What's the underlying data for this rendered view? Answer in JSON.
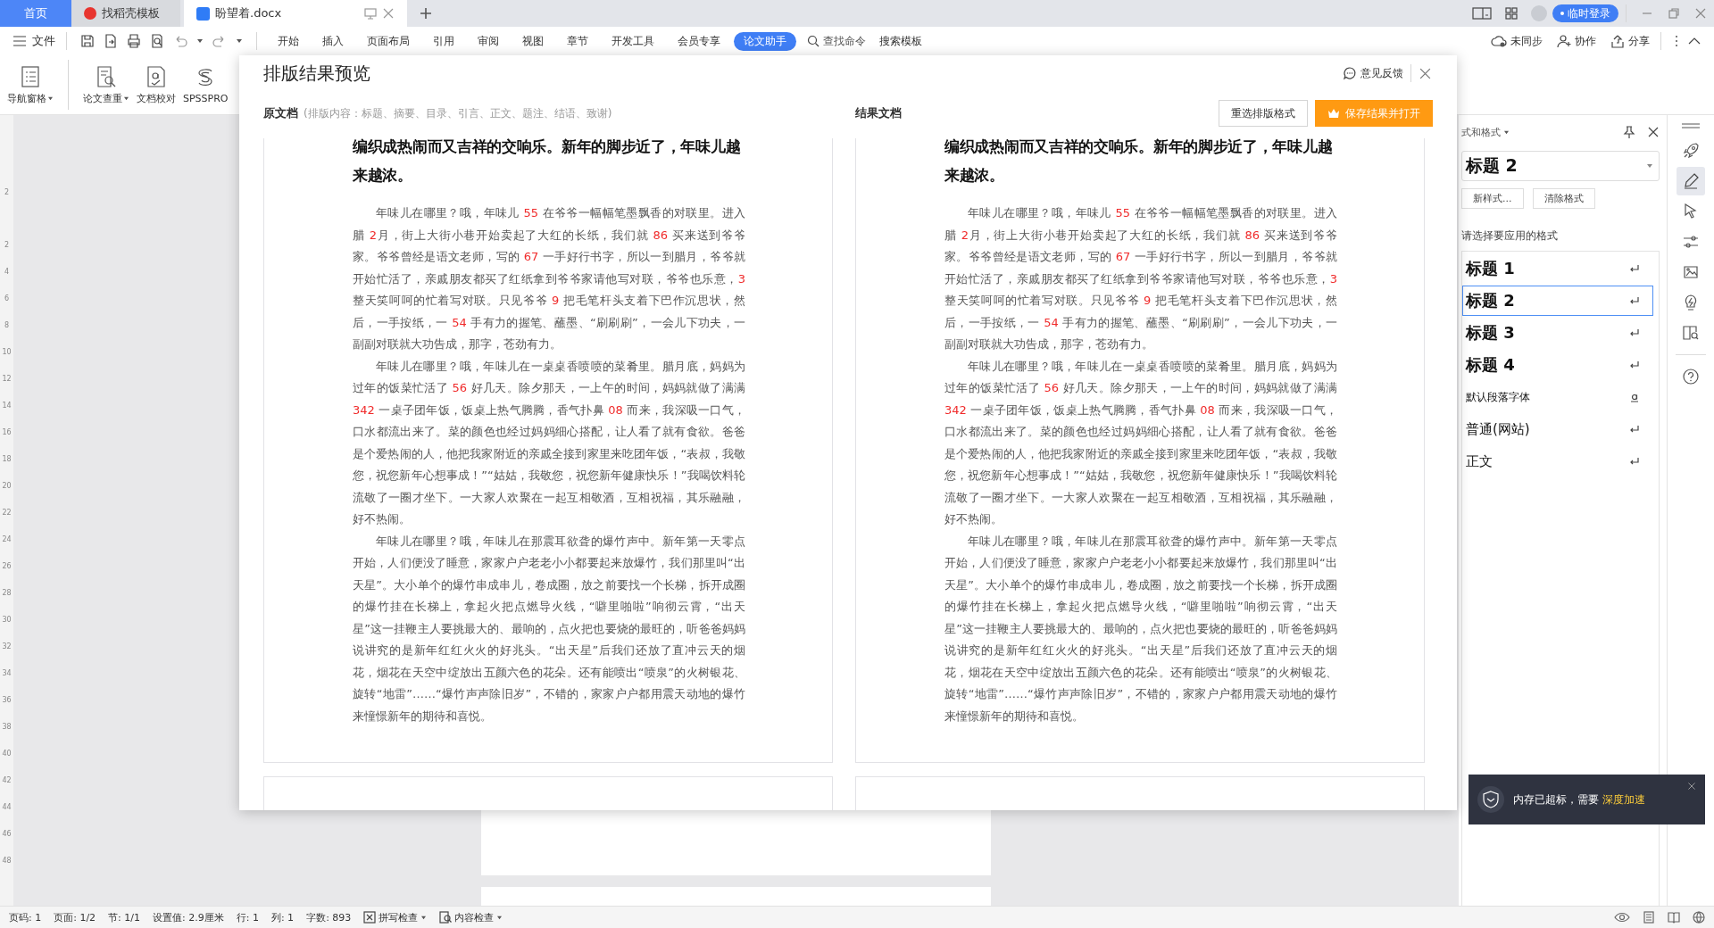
{
  "tab_bar": {
    "tabs": [
      {
        "label": "首页",
        "kind": "home",
        "selected": false
      },
      {
        "label": "找稻壳模板",
        "kind": "template",
        "selected": false
      },
      {
        "label": "盼望着.docx",
        "kind": "document",
        "selected": true
      }
    ],
    "login": "临时登录"
  },
  "toolbar": {
    "file_menu": "文件",
    "menu_tabs": [
      {
        "label": "开始",
        "selected": false
      },
      {
        "label": "插入",
        "selected": false
      },
      {
        "label": "页面布局",
        "selected": false
      },
      {
        "label": "引用",
        "selected": false
      },
      {
        "label": "审阅",
        "selected": false
      },
      {
        "label": "视图",
        "selected": false
      },
      {
        "label": "章节",
        "selected": false
      },
      {
        "label": "开发工具",
        "selected": false
      },
      {
        "label": "会员专享",
        "selected": false
      },
      {
        "label": "论文助手",
        "selected": true
      }
    ],
    "command_search": "查找命令",
    "template_search": "搜索模板",
    "actions": [
      {
        "label": "未同步",
        "kind": "sync"
      },
      {
        "label": "协作",
        "kind": "collab"
      },
      {
        "label": "分享",
        "kind": "share"
      }
    ]
  },
  "ribbon": {
    "items": [
      {
        "label": "导航窗格",
        "kind": "nav",
        "dropdown": true
      },
      {
        "label": "论文查重",
        "kind": "check",
        "dropdown": true
      },
      {
        "label": "文档校对",
        "kind": "proof",
        "dropdown": false
      },
      {
        "label": "SPSSPRO",
        "kind": "spss",
        "dropdown": false
      }
    ]
  },
  "ruler_marks": [
    "2",
    "2",
    "4",
    "6",
    "8",
    "10",
    "12",
    "14",
    "16",
    "18",
    "20",
    "22",
    "24",
    "26",
    "28",
    "30",
    "32",
    "34",
    "36",
    "38",
    "40",
    "42",
    "44",
    "46",
    "48"
  ],
  "dialog": {
    "title": "排版结果预览",
    "feedback": "意见反馈",
    "original_label": "原文档",
    "original_note": "(排版内容：标题、摘要、目录、引言、正文、题注、结语、致谢)",
    "result_label": "结果文档",
    "buttons": [
      {
        "label": "重选排版格式",
        "kind": "secondary"
      },
      {
        "label": "保存结果并打开",
        "kind": "primary"
      }
    ],
    "panes": [
      {
        "heading": "编织成热闹而又吉祥的交响乐。新年的脚步近了，年味儿越来越浓。",
        "paragraphs": [
          {
            "runs": [
              {
                "text": "年味儿在哪里？哦，年味儿 ",
                "marked": false
              },
              {
                "text": "55",
                "marked": true
              },
              {
                "text": " 在爷爷一幅幅笔墨飘香的对联里。进入腊 ",
                "marked": false
              },
              {
                "text": "2",
                "marked": true
              },
              {
                "text": "月，街上大街小巷开始卖起了大红的长纸，我们就 ",
                "marked": false
              },
              {
                "text": "86",
                "marked": true
              },
              {
                "text": " 买来送到爷爷家。爷爷曾经是语文老师，写的 ",
                "marked": false
              },
              {
                "text": "67",
                "marked": true
              },
              {
                "text": " 一手好行书字，所以一到腊月，爷爷就开始忙活了，亲戚朋友都买了红纸拿到爷爷家请他写对联，爷爷也乐意，",
                "marked": false
              },
              {
                "text": "3",
                "marked": true
              },
              {
                "text": " 整天笑呵呵的忙着写对联。只见爷爷 ",
                "marked": false
              },
              {
                "text": "9",
                "marked": true
              },
              {
                "text": " 把毛笔杆头支着下巴作沉思状，然后，一手按纸，一 ",
                "marked": false
              },
              {
                "text": "54",
                "marked": true
              },
              {
                "text": " 手有力的握笔、蘸墨、“刷刷刷”，一会儿下功夫，一副副对联就大功告成，那字，苍劲有力。",
                "marked": false
              }
            ]
          },
          {
            "runs": [
              {
                "text": "年味儿在哪里？哦，年味儿在一桌桌香喷喷的菜肴里。腊月底，妈妈为过年的饭菜忙活了 ",
                "marked": false
              },
              {
                "text": "56",
                "marked": true
              },
              {
                "text": " 好几天。除夕那天，一上午的时间，妈妈就做了满满 ",
                "marked": false
              },
              {
                "text": "342",
                "marked": true
              },
              {
                "text": " 一桌子团年饭，饭桌上热气腾腾，香气扑鼻 ",
                "marked": false
              },
              {
                "text": "08",
                "marked": true
              },
              {
                "text": " 而来，我深吸一口气，口水都流出来了。菜的颜色也经过妈妈细心搭配，让人看了就有食欲。爸爸是个爱热闹的人，他把我家附近的亲戚全接到家里来吃团年饭，“表叔，我敬您，祝您新年心想事成！”“姑姑，我敬您，祝您新年健康快乐！”我喝饮料轮流敬了一圈才坐下。一大家人欢聚在一起互相敬酒，互相祝福，其乐融融，好不热闹。",
                "marked": false
              }
            ]
          },
          {
            "runs": [
              {
                "text": "年味儿在哪里？哦，年味儿在那震耳欲聋的爆竹声中。新年第一天零点开始，人们便没了睡意，家家户户老老小小都要起来放爆竹，我们那里叫“出天星”。大小单个的爆竹串成串儿，卷成圈，放之前要找一个长梯，拆开成圈的爆竹挂在长梯上，拿起火把点燃导火线，“噼里啪啦”响彻云霄，“出天星”这一挂鞭主人要挑最大的、最响的，点火把也要烧的最旺的，听爸爸妈妈说讲究的是新年红红火火的好兆头。“出天星”后我们还放了直冲云天的烟花，烟花在天空中绽放出五颜六色的花朵。还有能喷出“喷泉”的火树银花、旋转“地雷”……“爆竹声声除旧岁”，不错的，家家户户都用震天动地的爆竹来憧憬新年的期待和喜悦。",
                "marked": false
              }
            ]
          }
        ]
      },
      {
        "heading": "编织成热闹而又吉祥的交响乐。新年的脚步近了，年味儿越来越浓。",
        "paragraphs": [
          {
            "runs": [
              {
                "text": "年味儿在哪里？哦，年味儿 ",
                "marked": false
              },
              {
                "text": "55",
                "marked": true
              },
              {
                "text": " 在爷爷一幅幅笔墨飘香的对联里。进入腊 ",
                "marked": false
              },
              {
                "text": "2",
                "marked": true
              },
              {
                "text": "月，街上大街小巷开始卖起了大红的长纸，我们就 ",
                "marked": false
              },
              {
                "text": "86",
                "marked": true
              },
              {
                "text": " 买来送到爷爷家。爷爷曾经是语文老师，写的 ",
                "marked": false
              },
              {
                "text": "67",
                "marked": true
              },
              {
                "text": " 一手好行书字，所以一到腊月，爷爷就开始忙活了，亲戚朋友都买了红纸拿到爷爷家请他写对联，爷爷也乐意，",
                "marked": false
              },
              {
                "text": "3",
                "marked": true
              },
              {
                "text": " 整天笑呵呵的忙着写对联。只见爷爷 ",
                "marked": false
              },
              {
                "text": "9",
                "marked": true
              },
              {
                "text": " 把毛笔杆头支着下巴作沉思状，然后，一手按纸，一 ",
                "marked": false
              },
              {
                "text": "54",
                "marked": true
              },
              {
                "text": " 手有力的握笔、蘸墨、“刷刷刷”，一会儿下功夫，一副副对联就大功告成，那字，苍劲有力。",
                "marked": false
              }
            ]
          },
          {
            "runs": [
              {
                "text": "年味儿在哪里？哦，年味儿在一桌桌香喷喷的菜肴里。腊月底，妈妈为过年的饭菜忙活了 ",
                "marked": false
              },
              {
                "text": "56",
                "marked": true
              },
              {
                "text": " 好几天。除夕那天，一上午的时间，妈妈就做了满满 ",
                "marked": false
              },
              {
                "text": "342",
                "marked": true
              },
              {
                "text": " 一桌子团年饭，饭桌上热气腾腾，香气扑鼻 ",
                "marked": false
              },
              {
                "text": "08",
                "marked": true
              },
              {
                "text": " 而来，我深吸一口气，口水都流出来了。菜的颜色也经过妈妈细心搭配，让人看了就有食欲。爸爸是个爱热闹的人，他把我家附近的亲戚全接到家里来吃团年饭，“表叔，我敬您，祝您新年心想事成！”“姑姑，我敬您，祝您新年健康快乐！”我喝饮料轮流敬了一圈才坐下。一大家人欢聚在一起互相敬酒，互相祝福，其乐融融，好不热闹。",
                "marked": false
              }
            ]
          },
          {
            "runs": [
              {
                "text": "年味儿在哪里？哦，年味儿在那震耳欲聋的爆竹声中。新年第一天零点开始，人们便没了睡意，家家户户老老小小都要起来放爆竹，我们那里叫“出天星”。大小单个的爆竹串成串儿，卷成圈，放之前要找一个长梯，拆开成圈的爆竹挂在长梯上，拿起火把点燃导火线，“噼里啪啦”响彻云霄，“出天星”这一挂鞭主人要挑最大的、最响的，点火把也要烧的最旺的，听爸爸妈妈说讲究的是新年红红火火的好兆头。“出天星”后我们还放了直冲云天的烟花，烟花在天空中绽放出五颜六色的花朵。还有能喷出“喷泉”的火树银花、旋转“地雷”……“爆竹声声除旧岁”，不错的，家家户户都用震天动地的爆竹来憧憬新年的期待和喜悦。",
                "marked": false
              }
            ]
          }
        ]
      }
    ]
  },
  "styles_panel": {
    "title": "式和格式",
    "current_style": "标题 2",
    "buttons": [
      "新样式...",
      "清除格式"
    ],
    "prompt": "请选择要应用的格式",
    "styles": [
      {
        "label": "标题 1",
        "kind": "heading",
        "selected": false
      },
      {
        "label": "标题 2",
        "kind": "heading",
        "selected": true
      },
      {
        "label": "标题 3",
        "kind": "heading",
        "selected": false
      },
      {
        "label": "标题 4",
        "kind": "heading",
        "selected": false
      },
      {
        "label": "默认段落字体",
        "kind": "character",
        "selected": false
      },
      {
        "label": "普通(网站)",
        "kind": "paragraph",
        "selected": false
      },
      {
        "label": "正文",
        "kind": "paragraph",
        "selected": false
      }
    ]
  },
  "notification": {
    "message": "内存已超标，需要 ",
    "link": "深度加速"
  },
  "status_bar": {
    "items": [
      "页码: 1",
      "页面: 1/2",
      "节: 1/1",
      "设置值: 2.9厘米",
      "行: 1",
      "列: 1",
      "字数: 893"
    ],
    "checks": [
      {
        "label": "拼写检查",
        "kind": "spell"
      },
      {
        "label": "内容检查",
        "kind": "content"
      }
    ]
  }
}
